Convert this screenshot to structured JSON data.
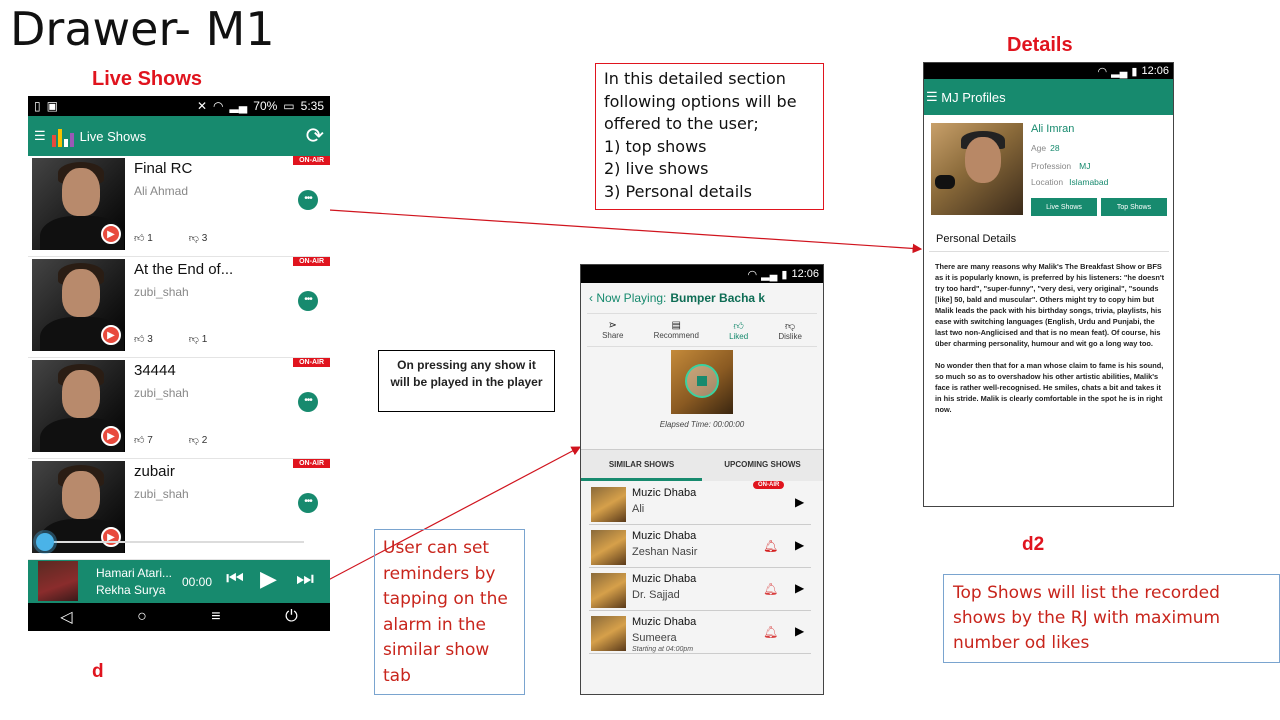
{
  "slide": {
    "title": "Drawer- M1",
    "live_shows_label": "Live Shows",
    "details_label": "Details",
    "label_d": "d",
    "label_d2": "d2"
  },
  "notes": {
    "detail_lines": [
      "In this detailed section",
      "following options will be",
      "offered to the user;",
      "1) top shows",
      "2) live shows",
      "3) Personal details"
    ],
    "press_note": "On pressing any show it will be played in the player",
    "reminder_note": "User can set reminders by tapping on the alarm in the similar show tab",
    "top_shows_note": "Top Shows will list the recorded shows by the RJ with maximum number od likes"
  },
  "live_app": {
    "status": {
      "battery": "70%",
      "time": "5:35"
    },
    "title": "Live Shows",
    "shows": [
      {
        "title": "Final RC",
        "artist": "Ali Ahmad",
        "badge": "ON-AIR",
        "likes": "1",
        "dislikes": "3"
      },
      {
        "title": "At the End of...",
        "artist": "zubi_shah",
        "badge": "ON-AIR",
        "likes": "3",
        "dislikes": "1"
      },
      {
        "title": "34444",
        "artist": "zubi_shah",
        "badge": "ON-AIR",
        "likes": "7",
        "dislikes": "2"
      },
      {
        "title": "zubair",
        "artist": "zubi_shah",
        "badge": "ON-AIR",
        "likes": "",
        "dislikes": ""
      }
    ],
    "seek_progress": 0.0,
    "mini_player": {
      "title": "Hamari Atari...",
      "artist": "Rekha Surya",
      "time": "00:00"
    }
  },
  "player_app": {
    "status_time": "12:06",
    "now_playing_prefix": "Now Playing:",
    "now_playing_title": "Bumper Bacha k",
    "actions": [
      "Share",
      "Recommend",
      "Liked",
      "Dislike"
    ],
    "elapsed": "Elapsed Time: 00:00:00",
    "tabs": [
      "SIMILAR SHOWS",
      "UPCOMING SHOWS"
    ],
    "similar": [
      {
        "name": "Muzic Dhaba",
        "artist": "Ali",
        "badge": "ON-AIR",
        "sub": ""
      },
      {
        "name": "Muzic Dhaba",
        "artist": "Zeshan Nasir",
        "badge": "",
        "sub": ""
      },
      {
        "name": "Muzic Dhaba",
        "artist": "Dr. Sajjad",
        "badge": "",
        "sub": ""
      },
      {
        "name": "Muzic Dhaba",
        "artist": "Sumeera",
        "badge": "",
        "sub": "Starting at 04:00pm"
      }
    ]
  },
  "profile_app": {
    "status_time": "12:06",
    "title": "MJ Profiles",
    "name": "Ali Imran",
    "age_label": "Age",
    "age": "28",
    "profession_label": "Profession",
    "profession": "MJ",
    "location_label": "Location",
    "location": "Islamabad",
    "btn_live": "Live Shows",
    "btn_top": "Top Shows",
    "section_title": "Personal Details",
    "para1": "There are many reasons why Malik's The Breakfast Show or BFS as it is popularly known, is preferred by his listeners: \"he doesn't try too hard\", \"super-funny\", \"very desi, very original\", \"sounds [like] 50, bald and muscular\". Others might try to copy him but Malik leads the pack with his birthday songs, trivia, playlists, his ease with switching languages (English, Urdu and Punjabi, the last two non-Anglicised and that is no mean feat). Of course, his über charming personality, humour and wit go a long way too.",
    "para2": "No wonder then that for a man whose claim to fame is his sound, so much so as to overshadow his other artistic abilities, Malik's face is rather well-recognised. He smiles, chats a bit and takes it in his stride. Malik is clearly comfortable in the spot he is in right now."
  },
  "colors": {
    "primary": "#178a6e",
    "accent_red": "#e0141e",
    "note_red": "#c8251c"
  }
}
